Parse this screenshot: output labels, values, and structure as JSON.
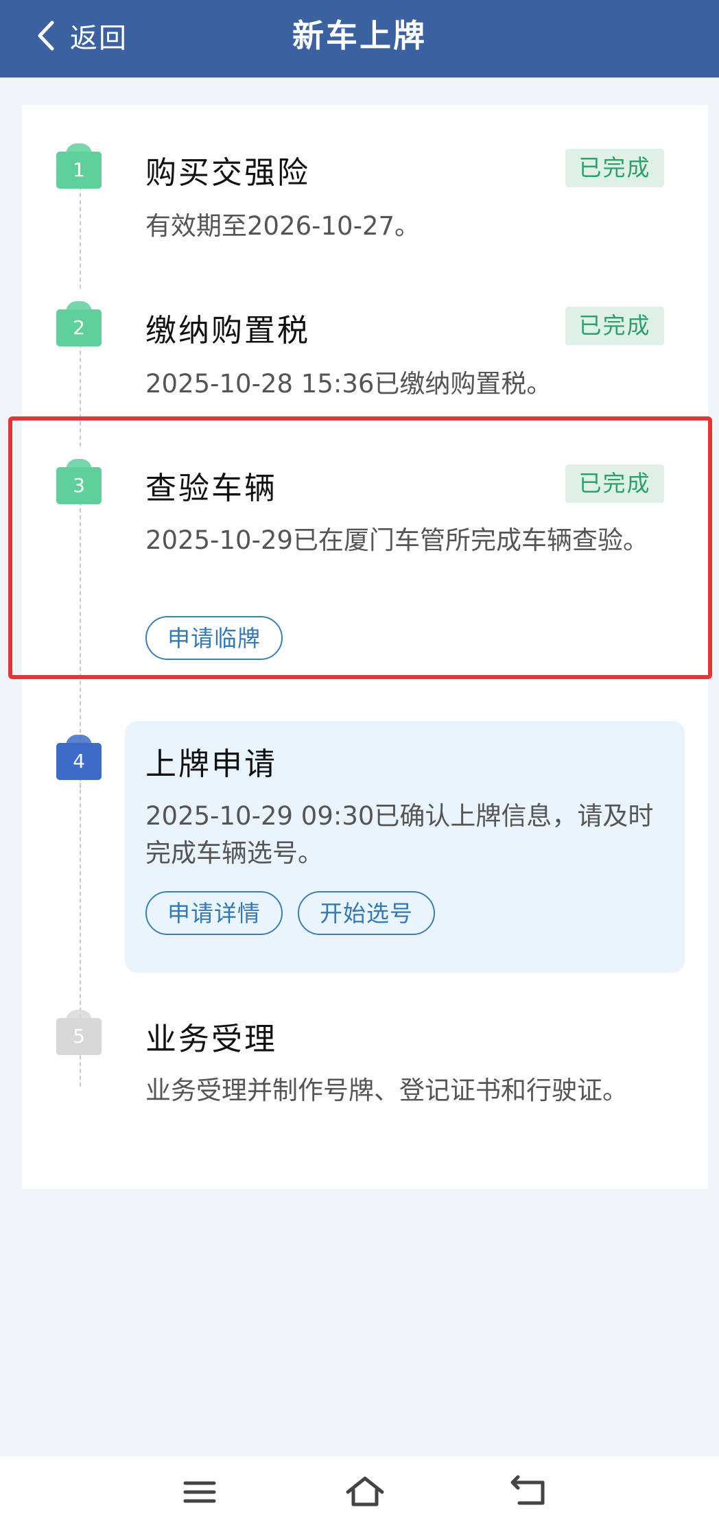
{
  "header": {
    "back_label": "返回",
    "title": "新车上牌"
  },
  "colors": {
    "header": "#3c61a0",
    "done": "#5fcf9c",
    "active": "#3e6bc7",
    "pending": "#d8d8d8",
    "highlight": "#e0383a",
    "link": "#3479b3"
  },
  "steps": [
    {
      "number": "1",
      "title": "购买交强险",
      "status": "已完成",
      "desc": "有效期至2026-10-27。"
    },
    {
      "number": "2",
      "title": "缴纳购置税",
      "status": "已完成",
      "desc": "2025-10-28 15:36已缴纳购置税。"
    },
    {
      "number": "3",
      "title": "查验车辆",
      "status": "已完成",
      "desc": "2025-10-29已在厦门车管所完成车辆查验。",
      "actions": [
        "申请临牌"
      ]
    },
    {
      "number": "4",
      "title": "上牌申请",
      "desc": "2025-10-29 09:30已确认上牌信息，请及时完成车辆选号。",
      "actions": [
        "申请详情",
        "开始选号"
      ]
    },
    {
      "number": "5",
      "title": "业务受理",
      "desc": "业务受理并制作号牌、登记证书和行驶证。"
    }
  ],
  "navbar": {
    "icons": [
      "menu-icon",
      "home-icon",
      "back-icon"
    ]
  }
}
